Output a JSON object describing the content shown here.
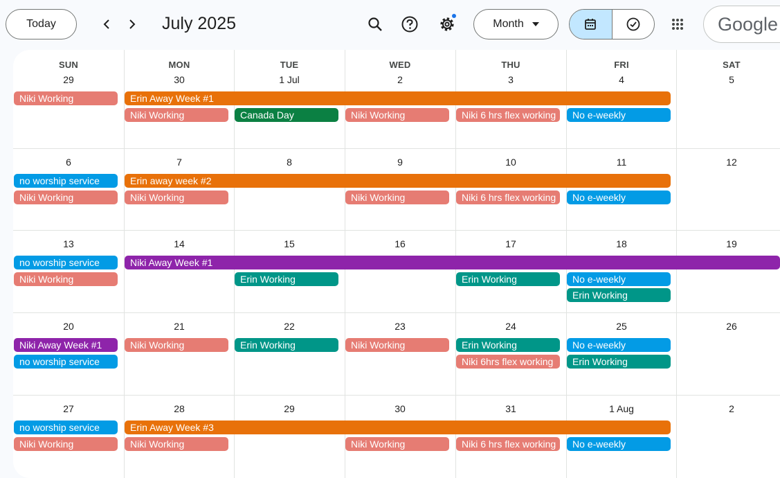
{
  "header": {
    "today_label": "Today",
    "title": "July 2025",
    "view_label": "Month",
    "brand": "Google"
  },
  "icons": {
    "prev": "chevron-left-icon",
    "next": "chevron-right-icon",
    "search": "search-icon",
    "help": "help-icon",
    "settings": "gear-icon",
    "view_dropdown": "caret-down-icon",
    "calendar_view": "calendar-icon",
    "tasks_view": "check-circle-icon",
    "apps": "apps-grid-icon"
  },
  "colors": {
    "orange": "#e8710a",
    "salmon": "#e67c73",
    "green_dark": "#0b8043",
    "teal": "#009688",
    "blue": "#039be5",
    "purple": "#8e24aa",
    "selected_view": "#c2e7ff"
  },
  "calendar": {
    "weekdays": [
      "SUN",
      "MON",
      "TUE",
      "WED",
      "THU",
      "FRI",
      "SAT"
    ],
    "weeks": [
      {
        "days": [
          "29",
          "30",
          "1 Jul",
          "2",
          "3",
          "4",
          "5"
        ],
        "events": [
          {
            "title": "Niki Working",
            "start": 0,
            "span": 1,
            "lane": 0,
            "color": "salmon"
          },
          {
            "title": "Erin Away Week #1",
            "start": 1,
            "span": 5,
            "lane": 0,
            "color": "orange"
          },
          {
            "title": "Niki Working",
            "start": 1,
            "span": 1,
            "lane": 1,
            "color": "salmon"
          },
          {
            "title": "Canada Day",
            "start": 2,
            "span": 1,
            "lane": 1,
            "color": "green_dark"
          },
          {
            "title": "Niki Working",
            "start": 3,
            "span": 1,
            "lane": 1,
            "color": "salmon"
          },
          {
            "title": "Niki 6 hrs flex working",
            "start": 4,
            "span": 1,
            "lane": 1,
            "color": "salmon"
          },
          {
            "title": "No e-weekly",
            "start": 5,
            "span": 1,
            "lane": 1,
            "color": "blue"
          }
        ]
      },
      {
        "days": [
          "6",
          "7",
          "8",
          "9",
          "10",
          "11",
          "12"
        ],
        "events": [
          {
            "title": "no worship service",
            "start": 0,
            "span": 1,
            "lane": 0,
            "color": "blue"
          },
          {
            "title": "Erin away week #2",
            "start": 1,
            "span": 5,
            "lane": 0,
            "color": "orange"
          },
          {
            "title": "Niki Working",
            "start": 0,
            "span": 1,
            "lane": 1,
            "color": "salmon"
          },
          {
            "title": "Niki Working",
            "start": 1,
            "span": 1,
            "lane": 1,
            "color": "salmon"
          },
          {
            "title": "Niki Working",
            "start": 3,
            "span": 1,
            "lane": 1,
            "color": "salmon"
          },
          {
            "title": "Niki 6 hrs flex working",
            "start": 4,
            "span": 1,
            "lane": 1,
            "color": "salmon"
          },
          {
            "title": "No e-weekly",
            "start": 5,
            "span": 1,
            "lane": 1,
            "color": "blue"
          }
        ]
      },
      {
        "days": [
          "13",
          "14",
          "15",
          "16",
          "17",
          "18",
          "19"
        ],
        "events": [
          {
            "title": "no worship service",
            "start": 0,
            "span": 1,
            "lane": 0,
            "color": "blue"
          },
          {
            "title": "Niki Away Week #1",
            "start": 1,
            "span": 6,
            "lane": 0,
            "color": "purple"
          },
          {
            "title": "Niki Working",
            "start": 0,
            "span": 1,
            "lane": 1,
            "color": "salmon"
          },
          {
            "title": "Erin Working",
            "start": 2,
            "span": 1,
            "lane": 1,
            "color": "teal"
          },
          {
            "title": "Erin Working",
            "start": 4,
            "span": 1,
            "lane": 1,
            "color": "teal"
          },
          {
            "title": "No e-weekly",
            "start": 5,
            "span": 1,
            "lane": 1,
            "color": "blue"
          },
          {
            "title": "Erin Working",
            "start": 5,
            "span": 1,
            "lane": 2,
            "color": "teal"
          }
        ]
      },
      {
        "days": [
          "20",
          "21",
          "22",
          "23",
          "24",
          "25",
          "26"
        ],
        "events": [
          {
            "title": "Niki Away Week #1",
            "start": 0,
            "span": 1,
            "lane": 0,
            "color": "purple"
          },
          {
            "title": "Niki Working",
            "start": 1,
            "span": 1,
            "lane": 0,
            "color": "salmon"
          },
          {
            "title": "Erin Working",
            "start": 2,
            "span": 1,
            "lane": 0,
            "color": "teal"
          },
          {
            "title": "Niki Working",
            "start": 3,
            "span": 1,
            "lane": 0,
            "color": "salmon"
          },
          {
            "title": "Erin Working",
            "start": 4,
            "span": 1,
            "lane": 0,
            "color": "teal"
          },
          {
            "title": "No e-weekly",
            "start": 5,
            "span": 1,
            "lane": 0,
            "color": "blue"
          },
          {
            "title": "no worship service",
            "start": 0,
            "span": 1,
            "lane": 1,
            "color": "blue"
          },
          {
            "title": "Niki 6hrs flex working",
            "start": 4,
            "span": 1,
            "lane": 1,
            "color": "salmon"
          },
          {
            "title": "Erin Working",
            "start": 5,
            "span": 1,
            "lane": 1,
            "color": "teal"
          }
        ]
      },
      {
        "days": [
          "27",
          "28",
          "29",
          "30",
          "31",
          "1 Aug",
          "2"
        ],
        "events": [
          {
            "title": "no worship service",
            "start": 0,
            "span": 1,
            "lane": 0,
            "color": "blue"
          },
          {
            "title": "Erin Away Week #3",
            "start": 1,
            "span": 5,
            "lane": 0,
            "color": "orange"
          },
          {
            "title": "Niki Working",
            "start": 0,
            "span": 1,
            "lane": 1,
            "color": "salmon"
          },
          {
            "title": "Niki Working",
            "start": 1,
            "span": 1,
            "lane": 1,
            "color": "salmon"
          },
          {
            "title": "Niki Working",
            "start": 3,
            "span": 1,
            "lane": 1,
            "color": "salmon"
          },
          {
            "title": "Niki 6 hrs flex working",
            "start": 4,
            "span": 1,
            "lane": 1,
            "color": "salmon"
          },
          {
            "title": "No e-weekly",
            "start": 5,
            "span": 1,
            "lane": 1,
            "color": "blue"
          }
        ]
      }
    ]
  }
}
